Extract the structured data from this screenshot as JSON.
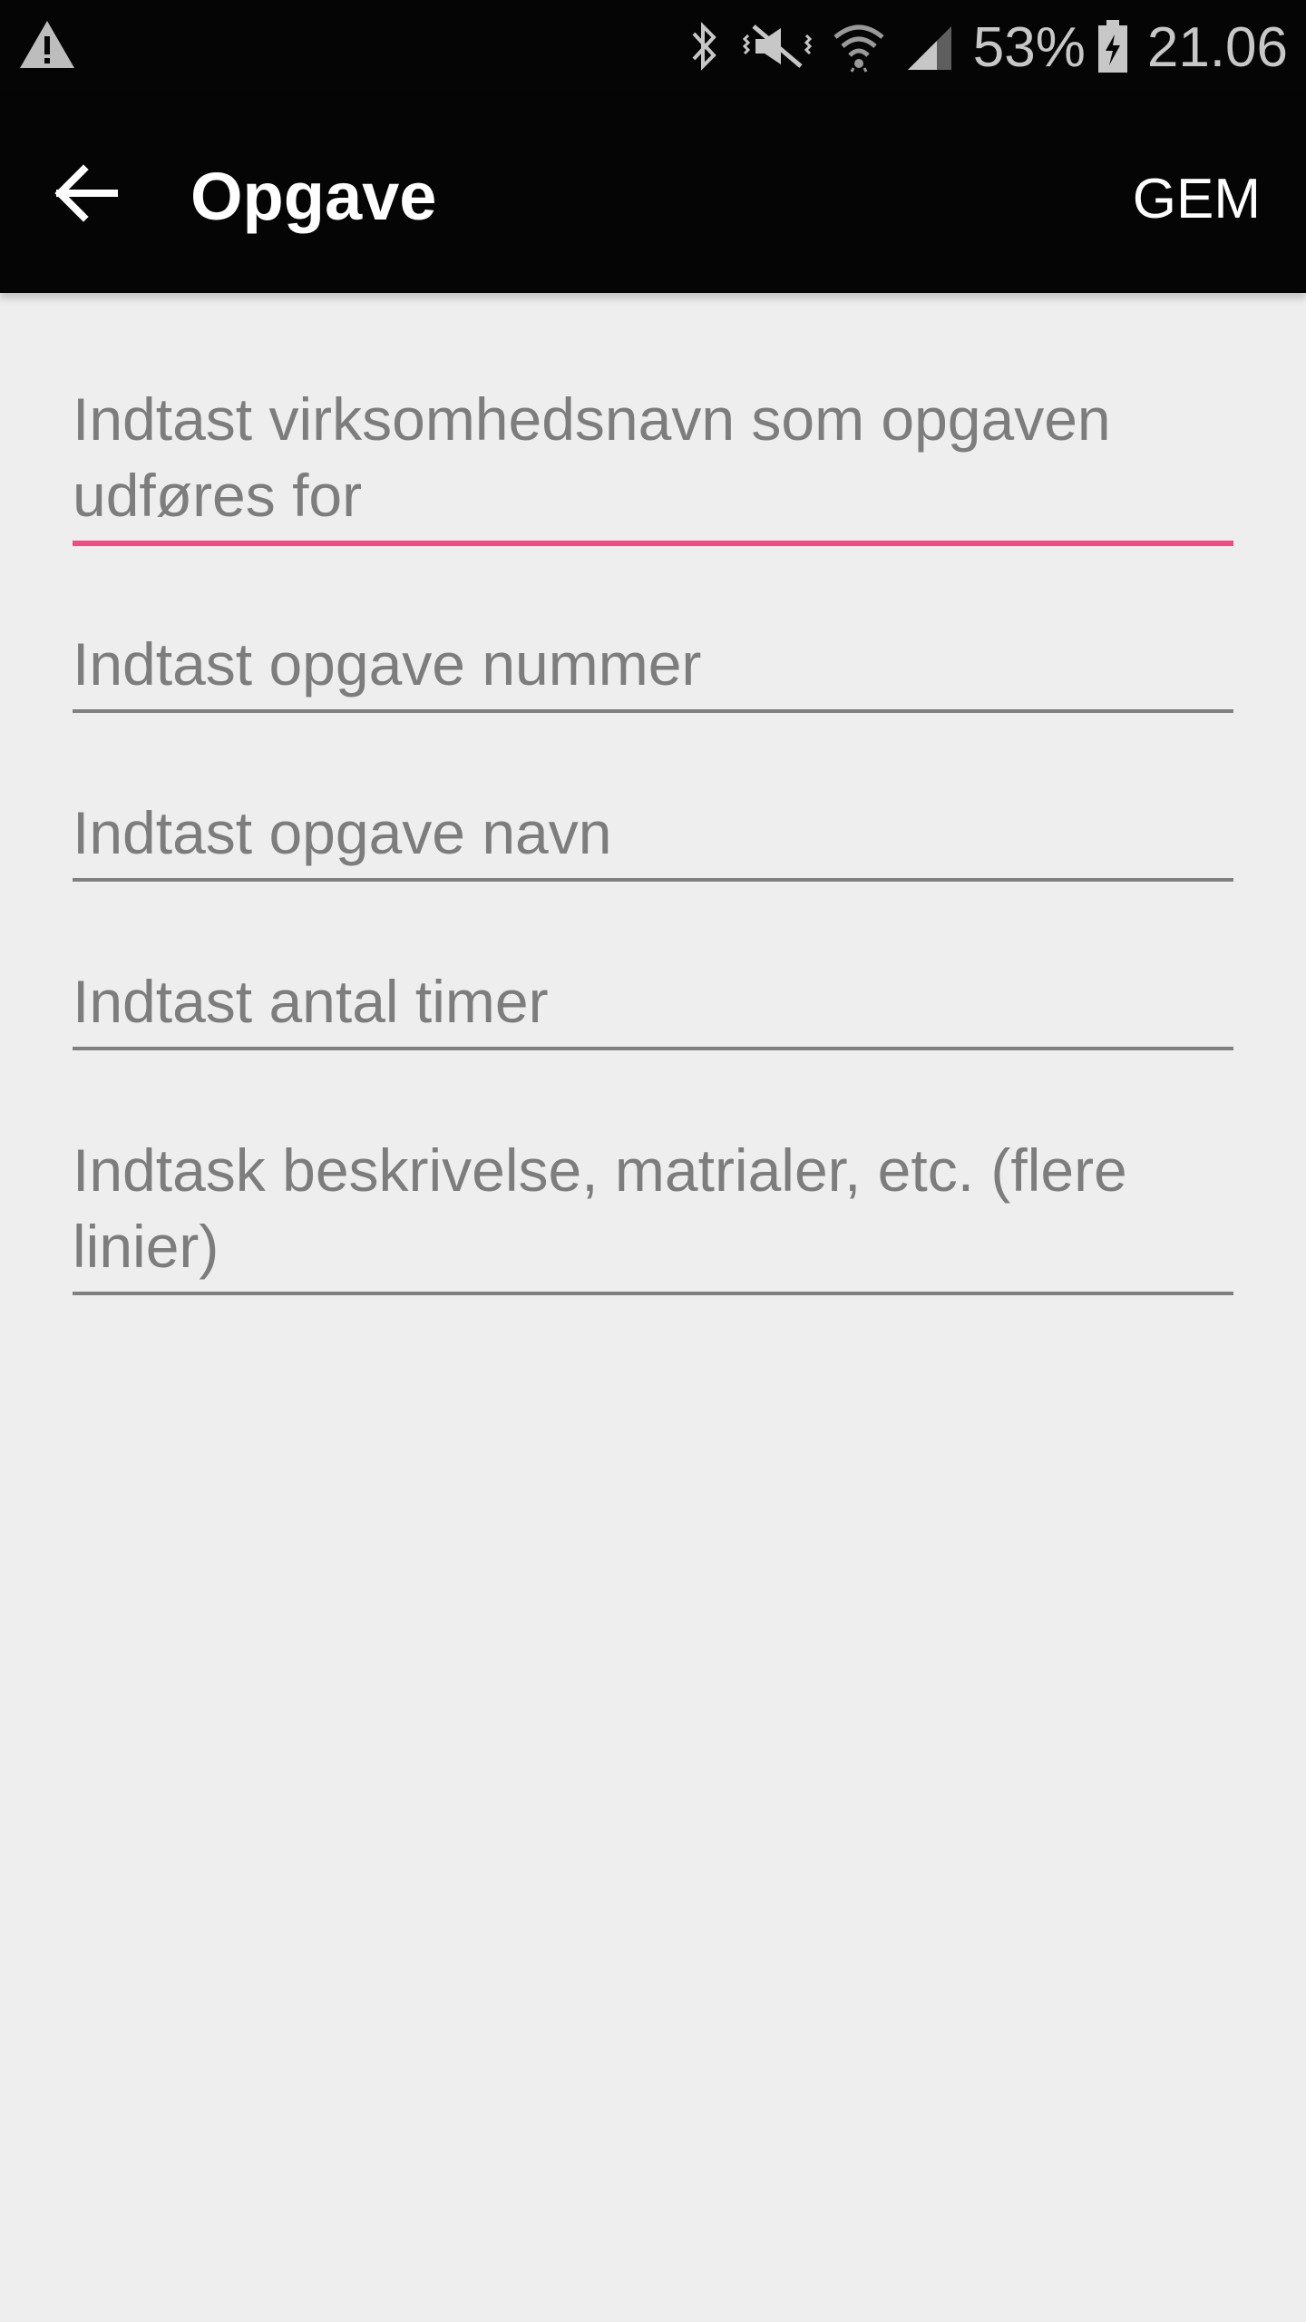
{
  "status_bar": {
    "battery_text": "53%",
    "time": "21.06",
    "icons": [
      "warning-icon",
      "bluetooth-icon",
      "mute-vibrate-icon",
      "wifi-icon",
      "signal-icon",
      "battery-charging-icon"
    ]
  },
  "app_bar": {
    "title": "Opgave",
    "save_label": "GEM",
    "back_icon": "arrow-left-icon"
  },
  "form": {
    "fields": [
      {
        "placeholder": "Indtast virksomhedsnavn som opgaven udføres for",
        "value": "",
        "focused": true
      },
      {
        "placeholder": "Indtast opgave nummer",
        "value": ""
      },
      {
        "placeholder": "Indtast opgave navn",
        "value": ""
      },
      {
        "placeholder": "Indtast antal timer",
        "value": ""
      },
      {
        "placeholder": "Indtask beskrivelse, matrialer, etc. (flere linier)",
        "value": ""
      }
    ]
  },
  "colors": {
    "app_bar_bg": "#050505",
    "page_bg": "#eeeeef",
    "accent": "#ee4c82",
    "underline": "#808080",
    "placeholder_text": "#7d7d7d"
  }
}
